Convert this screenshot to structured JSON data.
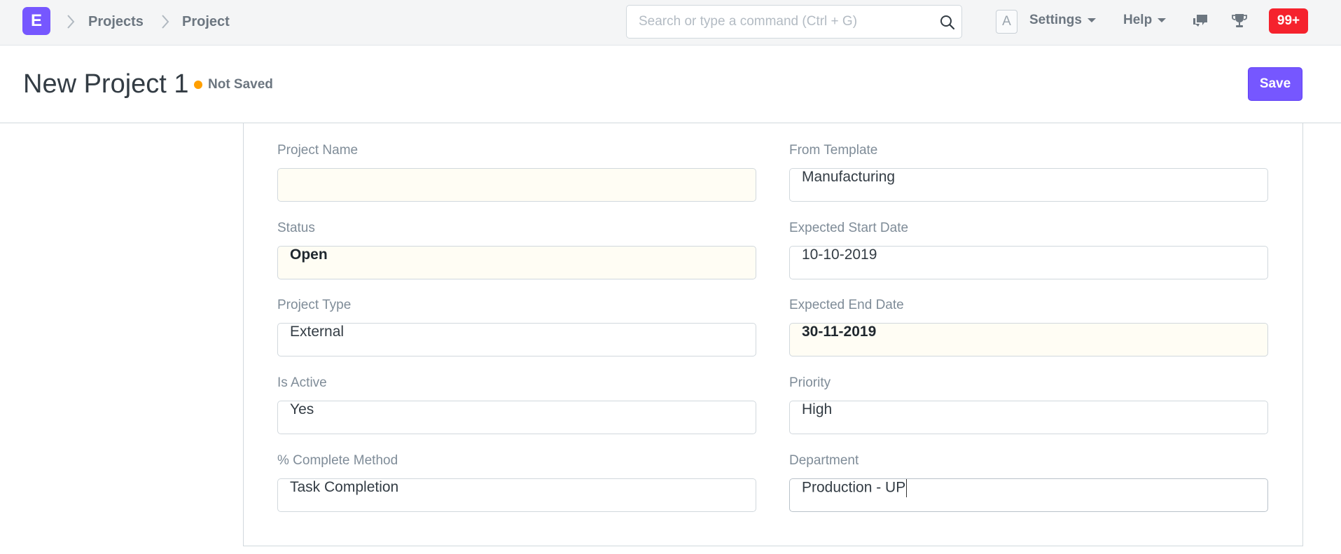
{
  "navbar": {
    "logo_letter": "E",
    "breadcrumbs": [
      "Projects",
      "Project"
    ],
    "search_placeholder": "Search or type a command (Ctrl + G)",
    "avatar_letter": "A",
    "settings_label": "Settings",
    "help_label": "Help",
    "notification_count": "99+",
    "icons": [
      "chevron-right-icon",
      "search-icon",
      "chat-icon",
      "trophy-icon"
    ],
    "accent_color": "#7657ff",
    "notification_color": "#f5222d"
  },
  "page": {
    "title": "New Project 1",
    "status": "Not Saved",
    "status_color": "#ff9f00",
    "save_label": "Save"
  },
  "form": {
    "left": [
      {
        "label": "Project Name",
        "value": ""
      },
      {
        "label": "Status",
        "value": "Open"
      },
      {
        "label": "Project Type",
        "value": "External"
      },
      {
        "label": "Is Active",
        "value": "Yes"
      },
      {
        "label": "% Complete Method",
        "value": "Task Completion"
      }
    ],
    "right": [
      {
        "label": "From Template",
        "value": "Manufacturing"
      },
      {
        "label": "Expected Start Date",
        "value": "10-10-2019"
      },
      {
        "label": "Expected End Date",
        "value": "30-11-2019"
      },
      {
        "label": "Priority",
        "value": "High"
      },
      {
        "label": "Department",
        "value": "Production - UP"
      }
    ]
  }
}
